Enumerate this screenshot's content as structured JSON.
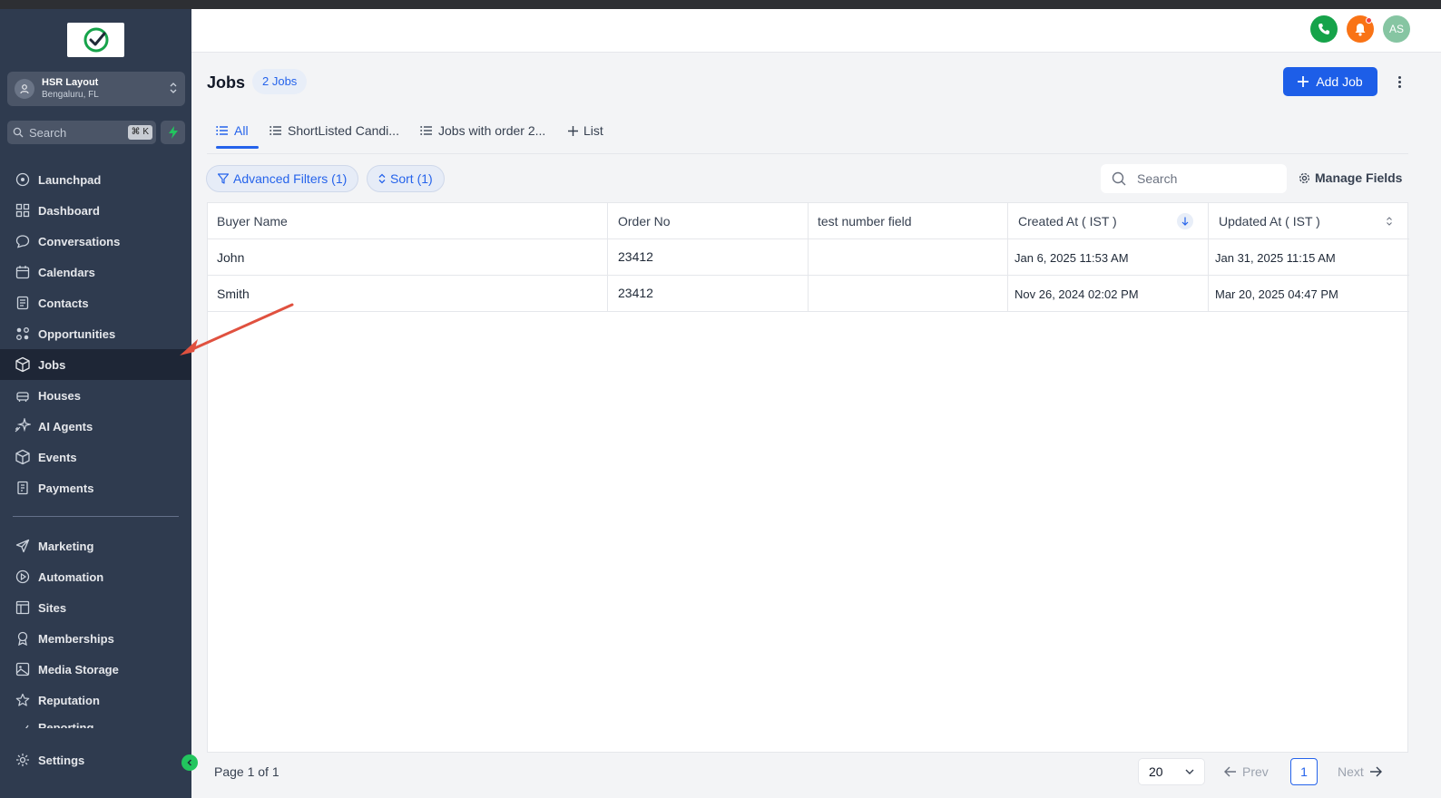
{
  "sidebar": {
    "location": {
      "name": "HSR Layout",
      "sub": "Bengaluru, FL"
    },
    "search": {
      "placeholder": "Search",
      "shortcut": "⌘ K"
    },
    "items": [
      {
        "label": "Launchpad",
        "icon": "launchpad-icon"
      },
      {
        "label": "Dashboard",
        "icon": "dashboard-icon"
      },
      {
        "label": "Conversations",
        "icon": "chat-bubble-icon"
      },
      {
        "label": "Calendars",
        "icon": "calendar-icon"
      },
      {
        "label": "Contacts",
        "icon": "contacts-icon"
      },
      {
        "label": "Opportunities",
        "icon": "opportunities-icon"
      },
      {
        "label": "Jobs",
        "icon": "cube-icon",
        "active": true
      },
      {
        "label": "Houses",
        "icon": "house-icon"
      },
      {
        "label": "AI Agents",
        "icon": "sparkle-icon"
      },
      {
        "label": "Events",
        "icon": "cube-icon"
      },
      {
        "label": "Payments",
        "icon": "invoice-icon"
      }
    ],
    "items2": [
      {
        "label": "Marketing",
        "icon": "send-icon"
      },
      {
        "label": "Automation",
        "icon": "automation-icon"
      },
      {
        "label": "Sites",
        "icon": "sites-icon"
      },
      {
        "label": "Memberships",
        "icon": "award-icon"
      },
      {
        "label": "Media Storage",
        "icon": "image-icon"
      },
      {
        "label": "Reputation",
        "icon": "star-icon"
      },
      {
        "label": "Reporting",
        "icon": "chart-icon"
      }
    ],
    "settings_label": "Settings"
  },
  "header": {
    "avatar_initials": "AS"
  },
  "page": {
    "title": "Jobs",
    "count_badge": "2 Jobs",
    "add_button": "Add Job"
  },
  "tabs": [
    {
      "label": "All",
      "active": true
    },
    {
      "label": "ShortListed Candi..."
    },
    {
      "label": "Jobs with order 2..."
    },
    {
      "label": "List"
    }
  ],
  "filters": {
    "advanced": "Advanced Filters (1)",
    "sort": "Sort (1)",
    "search_placeholder": "Search",
    "manage_fields": "Manage Fields"
  },
  "table": {
    "columns": [
      "Buyer Name",
      "Order No",
      "test number field",
      "Created At ( IST )",
      "Updated At ( IST )"
    ],
    "rows": [
      [
        "John",
        "23412",
        "",
        "Jan 6, 2025 11:53 AM",
        "Jan 31, 2025 11:15 AM"
      ],
      [
        "Smith",
        "23412",
        "",
        "Nov 26, 2024 02:02 PM",
        "Mar 20, 2025 04:47 PM"
      ]
    ]
  },
  "footer": {
    "page_info": "Page 1 of 1",
    "per_page": "20",
    "prev": "Prev",
    "current_page": "1",
    "next": "Next"
  },
  "colors": {
    "sidebar_bg": "#2f3b4f",
    "accent": "#1d5ee8",
    "annotation_arrow": "#e0513f"
  }
}
